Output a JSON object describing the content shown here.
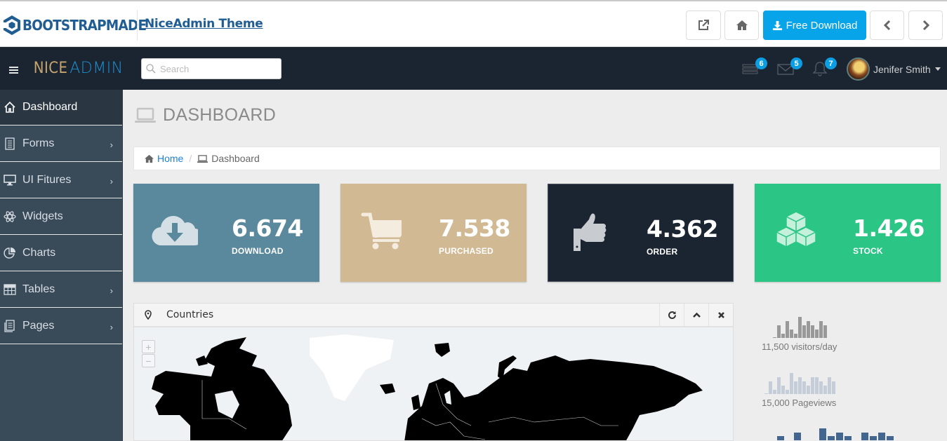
{
  "promo": {
    "logo_text": "BOOTSTRAPMADE",
    "theme_link": "NiceAdmin Theme",
    "buttons": {
      "external": "external-link-icon",
      "home": "home-icon",
      "download_label": "Free Download",
      "prev": "chevron-left-icon",
      "next": "chevron-right-icon"
    }
  },
  "header": {
    "brand_nice": "NICE",
    "brand_admin": "ADMIN",
    "search_placeholder": "Search",
    "tasks_badge": "6",
    "mail_badge": "5",
    "notifications_badge": "7",
    "user_name": "Jenifer Smith"
  },
  "sidebar": {
    "items": [
      {
        "label": "Dashboard",
        "icon": "home-icon",
        "active": true,
        "has_submenu": false
      },
      {
        "label": "Forms",
        "icon": "document-icon",
        "has_submenu": true
      },
      {
        "label": "UI Fitures",
        "icon": "desktop-icon",
        "has_submenu": true
      },
      {
        "label": "Widgets",
        "icon": "atom-icon",
        "has_submenu": false
      },
      {
        "label": "Charts",
        "icon": "pie-chart-icon",
        "has_submenu": false
      },
      {
        "label": "Tables",
        "icon": "table-icon",
        "has_submenu": true
      },
      {
        "label": "Pages",
        "icon": "pages-icon",
        "has_submenu": true
      }
    ],
    "chevron": "›"
  },
  "page": {
    "title": "DASHBOARD",
    "breadcrumb": {
      "home": "Home",
      "separator": "/",
      "current": "Dashboard"
    }
  },
  "cards": [
    {
      "value": "6.674",
      "label": "DOWNLOAD",
      "icon": "cloud-download-icon",
      "color": "#5a889c"
    },
    {
      "value": "7.538",
      "label": "PURCHASED",
      "icon": "shopping-cart-icon",
      "color": "#d1b993"
    },
    {
      "value": "4.362",
      "label": "ORDER",
      "icon": "thumbs-up-icon",
      "color": "#1b2431"
    },
    {
      "value": "1.426",
      "label": "STOCK",
      "icon": "cubes-icon",
      "color": "#2bc685"
    }
  ],
  "panel": {
    "title": "Countries",
    "zoom_in": "+",
    "zoom_out": "−"
  },
  "stats": [
    {
      "label": "11,500 visitors/day",
      "color": "#999999",
      "bars": [
        0.05,
        6,
        2,
        8,
        4,
        2,
        10,
        6,
        8,
        6,
        4,
        8,
        6
      ]
    },
    {
      "label": "15,000 Pageviews",
      "color": "#c5ced8",
      "bars": [
        0.05,
        6,
        2,
        8,
        4,
        2,
        10,
        6,
        8,
        6,
        4,
        8,
        8,
        6,
        4,
        8,
        6
      ]
    },
    {
      "label": "",
      "color": "#42668f",
      "bars": [
        0,
        1,
        0,
        2,
        0,
        0,
        3,
        1,
        2,
        1,
        0,
        2,
        1,
        2,
        1
      ]
    }
  ]
}
